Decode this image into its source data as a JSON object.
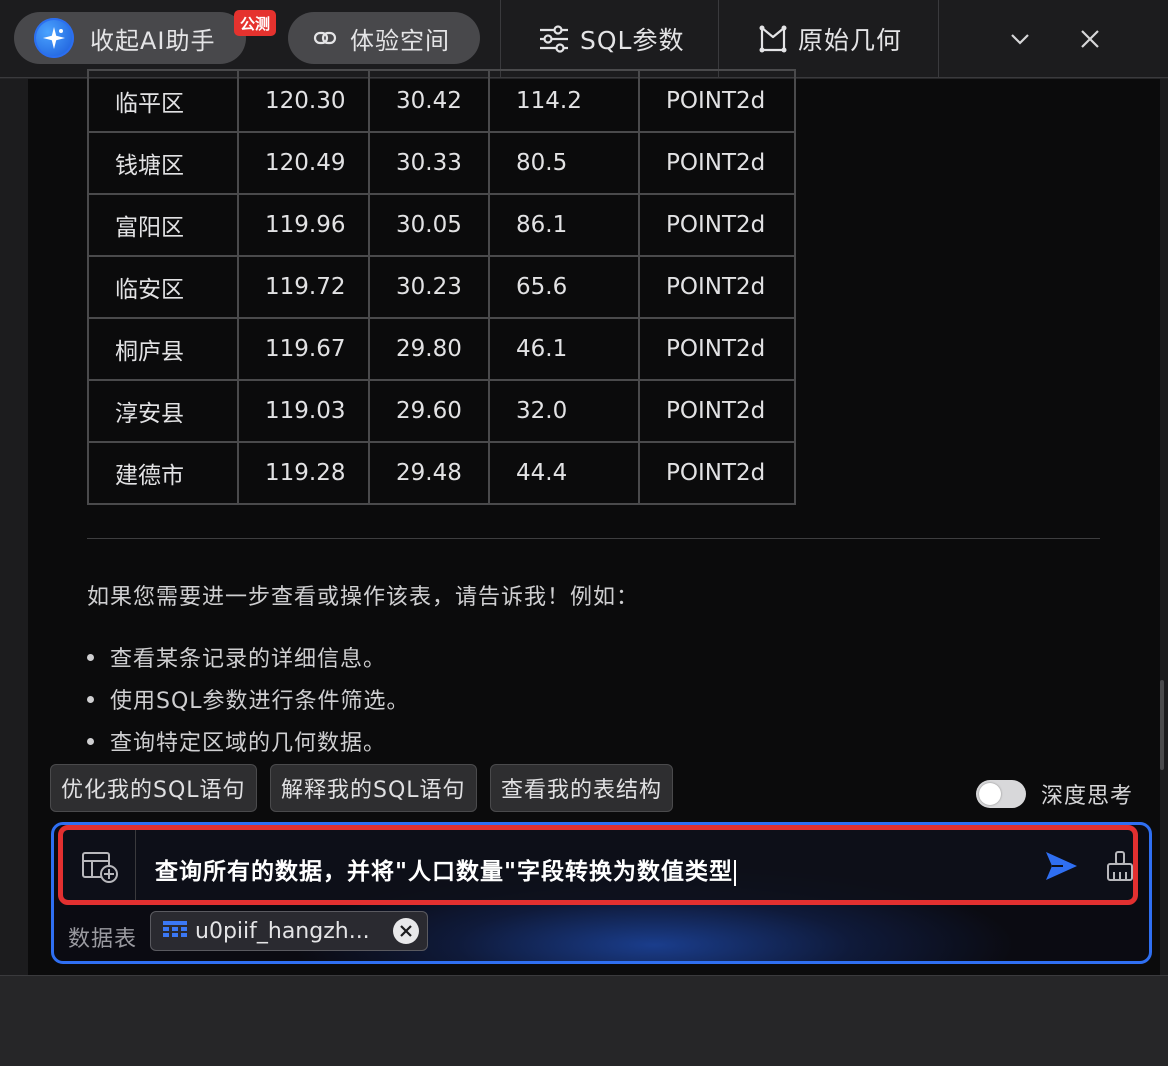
{
  "toolbar": {
    "ai_label": "收起AI助手",
    "ai_badge": "公测",
    "experience_label": "体验空间",
    "sql_params_label": "SQL参数",
    "raw_geometry_label": "原始几何"
  },
  "table": {
    "rows": [
      [
        "临平区",
        "120.30",
        "30.42",
        "114.2",
        "POINT2d"
      ],
      [
        "钱塘区",
        "120.49",
        "30.33",
        "80.5",
        "POINT2d"
      ],
      [
        "富阳区",
        "119.96",
        "30.05",
        "86.1",
        "POINT2d"
      ],
      [
        "临安区",
        "119.72",
        "30.23",
        "65.6",
        "POINT2d"
      ],
      [
        "桐庐县",
        "119.67",
        "29.80",
        "46.1",
        "POINT2d"
      ],
      [
        "淳安县",
        "119.03",
        "29.60",
        "32.0",
        "POINT2d"
      ],
      [
        "建德市",
        "119.28",
        "29.48",
        "44.4",
        "POINT2d"
      ]
    ]
  },
  "message": {
    "intro": "如果您需要进一步查看或操作该表，请告诉我！例如：",
    "bullets": [
      "查看某条记录的详细信息。",
      "使用SQL参数进行条件筛选。",
      "查询特定区域的几何数据。"
    ]
  },
  "quick_actions": [
    "优化我的SQL语句",
    "解释我的SQL语句",
    "查看我的表结构"
  ],
  "deep_think": {
    "label": "深度思考",
    "enabled": false
  },
  "input": {
    "value": "查询所有的数据，并将\"人口数量\"字段转换为数值类型",
    "table_label": "数据表",
    "selected_table": "u0piif_hangzh..."
  },
  "colors": {
    "accent": "#2f6ff2",
    "highlight": "#e23030",
    "badge": "#e5322e"
  }
}
